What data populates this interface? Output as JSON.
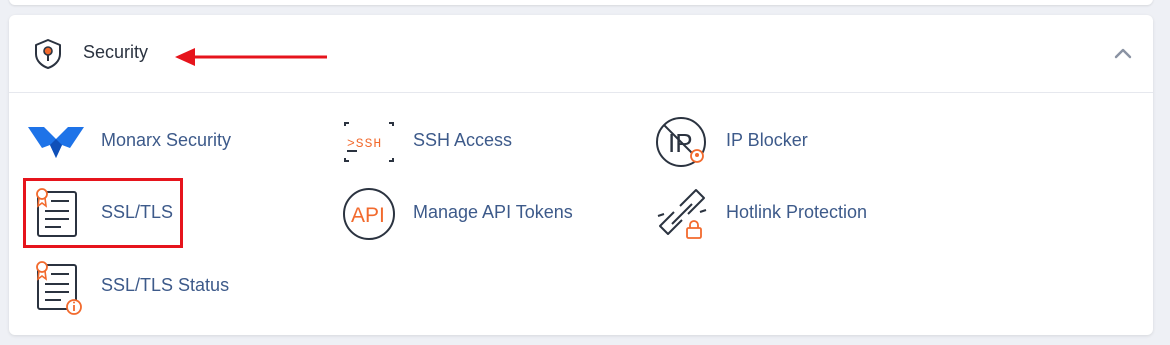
{
  "section": {
    "title": "Security",
    "expanded": true
  },
  "items": [
    {
      "label": "Monarx Security",
      "icon": "monarx-logo-icon"
    },
    {
      "label": "SSH Access",
      "icon": "terminal-ssh-icon"
    },
    {
      "label": "IP Blocker",
      "icon": "ip-blocker-icon"
    },
    {
      "label": "SSL/TLS",
      "icon": "certificate-document-icon"
    },
    {
      "label": "Manage API Tokens",
      "icon": "api-circle-icon"
    },
    {
      "label": "Hotlink Protection",
      "icon": "broken-link-lock-icon"
    },
    {
      "label": "SSL/TLS Status",
      "icon": "certificate-info-icon"
    }
  ],
  "icon_text": {
    "ssh": ">SSH",
    "ip": "IP",
    "api": "API"
  },
  "colors": {
    "accent_orange": "#f26a2d",
    "link_blue": "#3d5a8a",
    "annotation_red": "#e6141c",
    "monarx_blue": "#1e73e8"
  }
}
